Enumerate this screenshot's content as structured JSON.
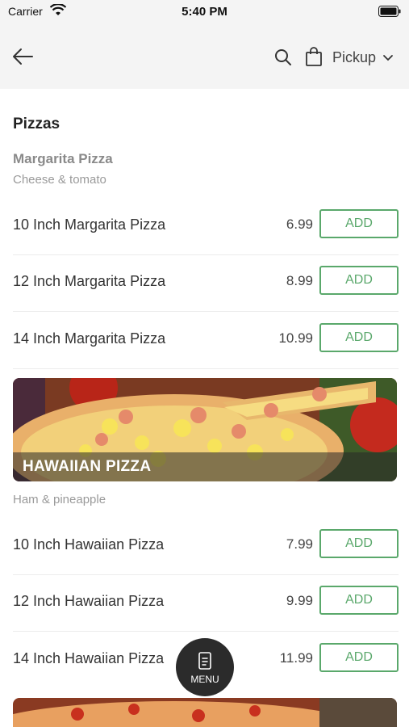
{
  "status_bar": {
    "carrier": "Carrier",
    "time": "5:40 PM"
  },
  "nav": {
    "back_icon": "arrow-left-icon",
    "search_icon": "search-icon",
    "bag_icon": "shopping-bag-icon",
    "pickup_label": "Pickup"
  },
  "section": {
    "title": "Pizzas"
  },
  "margarita": {
    "name": "Margarita Pizza",
    "description": "Cheese & tomato",
    "items": [
      {
        "name": "10 Inch Margarita Pizza",
        "price": "6.99",
        "button": "ADD"
      },
      {
        "name": "12 Inch Margarita Pizza",
        "price": "8.99",
        "button": "ADD"
      },
      {
        "name": "14 Inch Margarita Pizza",
        "price": "10.99",
        "button": "ADD"
      }
    ]
  },
  "hawaiian": {
    "name": "HAWAIIAN PIZZA",
    "description": "Ham & pineapple",
    "items": [
      {
        "name": "10 Inch Hawaiian Pizza",
        "price": "7.99",
        "button": "ADD"
      },
      {
        "name": "12 Inch Hawaiian Pizza",
        "price": "9.99",
        "button": "ADD"
      },
      {
        "name": "14 Inch Hawaiian Pizza",
        "price": "11.99",
        "button": "ADD"
      }
    ]
  },
  "fab": {
    "label": "MENU",
    "icon": "menu-card-icon"
  },
  "colors": {
    "accent": "#5aa86b",
    "nav_bg": "#f4f4f4",
    "fab_bg": "#2b2b2b"
  }
}
